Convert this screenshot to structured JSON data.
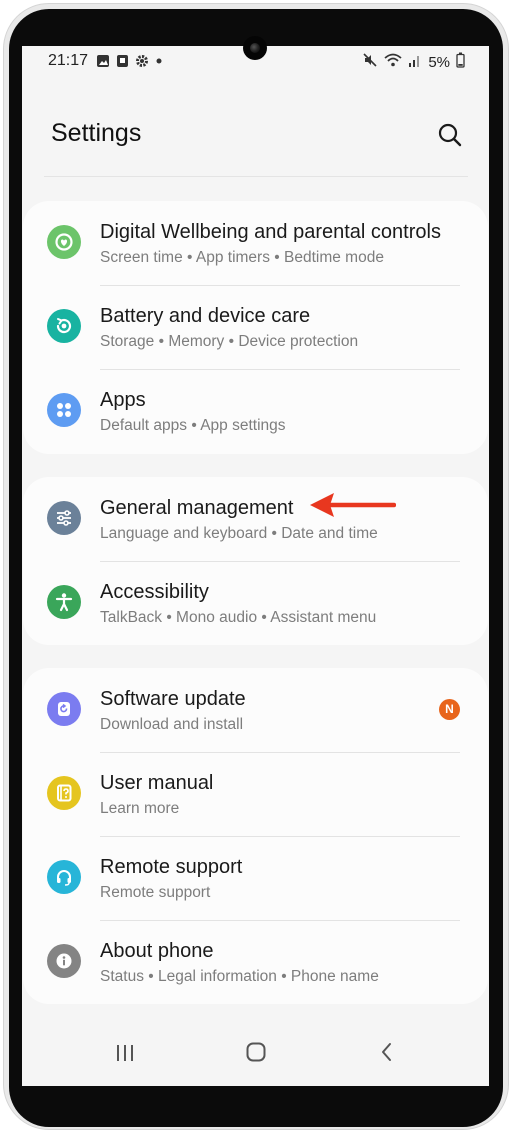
{
  "status_bar": {
    "time": "21:17",
    "battery_percent": "5%",
    "left_icons": [
      "gallery-icon",
      "notification-icon",
      "gear-icon",
      "dot-icon"
    ],
    "right_icons": [
      "mute-icon",
      "wifi-icon",
      "signal-icon",
      "battery-icon"
    ]
  },
  "header": {
    "title": "Settings",
    "search_icon": "search-icon"
  },
  "groups": [
    {
      "items": [
        {
          "title": "Digital Wellbeing and parental controls",
          "subtitle": "Screen time  •  App timers  •  Bedtime mode",
          "icon": "wellbeing-icon",
          "icon_color": "#6cc46a"
        },
        {
          "title": "Battery and device care",
          "subtitle": "Storage  •  Memory  •  Device protection",
          "icon": "device-care-icon",
          "icon_color": "#18b3a1"
        },
        {
          "title": "Apps",
          "subtitle": "Default apps  •  App settings",
          "icon": "apps-icon",
          "icon_color": "#5e9cf2"
        }
      ]
    },
    {
      "items": [
        {
          "title": "General management",
          "subtitle": "Language and keyboard  •  Date and time",
          "icon": "sliders-icon",
          "icon_color": "#6b8199"
        },
        {
          "title": "Accessibility",
          "subtitle": "TalkBack  •  Mono audio  •  Assistant menu",
          "icon": "accessibility-icon",
          "icon_color": "#3aa65a"
        }
      ]
    },
    {
      "items": [
        {
          "title": "Software update",
          "subtitle": "Download and install",
          "icon": "software-update-icon",
          "icon_color": "#7b7cf0",
          "badge": "N"
        },
        {
          "title": "User manual",
          "subtitle": "Learn more",
          "icon": "manual-icon",
          "icon_color": "#e5c51f"
        },
        {
          "title": "Remote support",
          "subtitle": "Remote support",
          "icon": "headset-icon",
          "icon_color": "#27b5d8"
        },
        {
          "title": "About phone",
          "subtitle": "Status  •  Legal information  •  Phone name",
          "icon": "info-icon",
          "icon_color": "#848484"
        }
      ]
    }
  ],
  "annotation": {
    "icon": "red-arrow-icon",
    "color": "#e8371f"
  },
  "navbar": {
    "icons": [
      "recent-apps-icon",
      "home-icon",
      "back-icon"
    ]
  }
}
